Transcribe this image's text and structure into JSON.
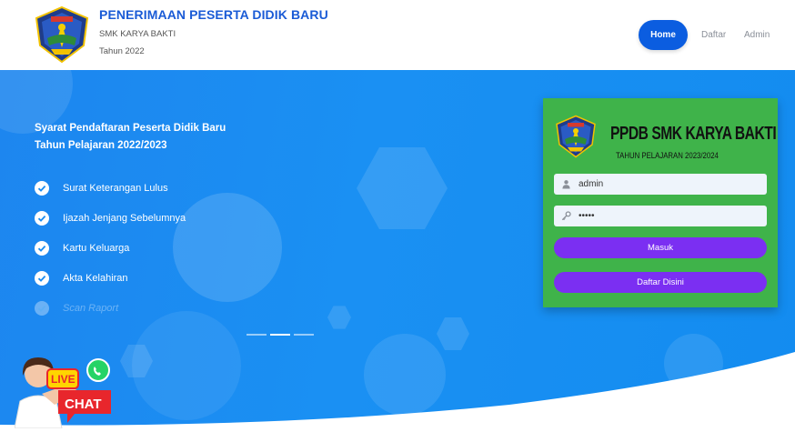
{
  "header": {
    "title": "PENERIMAAN PESERTA DIDIK BARU",
    "school": "SMK KARYA BAKTI",
    "year": "Tahun 2022",
    "nav": {
      "home": "Home",
      "daftar": "Daftar",
      "admin": "Admin"
    }
  },
  "hero": {
    "title_line1": "Syarat Pendaftaran Peserta Didik Baru",
    "title_line2": "Tahun Pelajaran 2022/2023",
    "requirements": [
      "Surat Keterangan Lulus",
      "Ijazah Jenjang Sebelumnya",
      "Kartu Keluarga",
      "Akta Kelahiran",
      "Scan Raport"
    ]
  },
  "login": {
    "title": "PPDB SMK KARYA BAKTI",
    "subtitle": "TAHUN PELAJARAN 2023/2024",
    "username_value": "admin",
    "password_value": "•••••",
    "submit_label": "Masuk",
    "register_label": "Daftar Disini"
  },
  "livechat": {
    "live": "LIVE",
    "chat": "CHAT"
  },
  "colors": {
    "primary": "#0b5de0",
    "hero": "#1a90f3",
    "card": "#3fb34a",
    "button": "#7b2ff2",
    "chat_red": "#e8262c",
    "chat_yellow": "#ffd400"
  },
  "icons": [
    "check-circle-icon",
    "user-icon",
    "key-icon",
    "whatsapp-icon",
    "school-logo"
  ]
}
